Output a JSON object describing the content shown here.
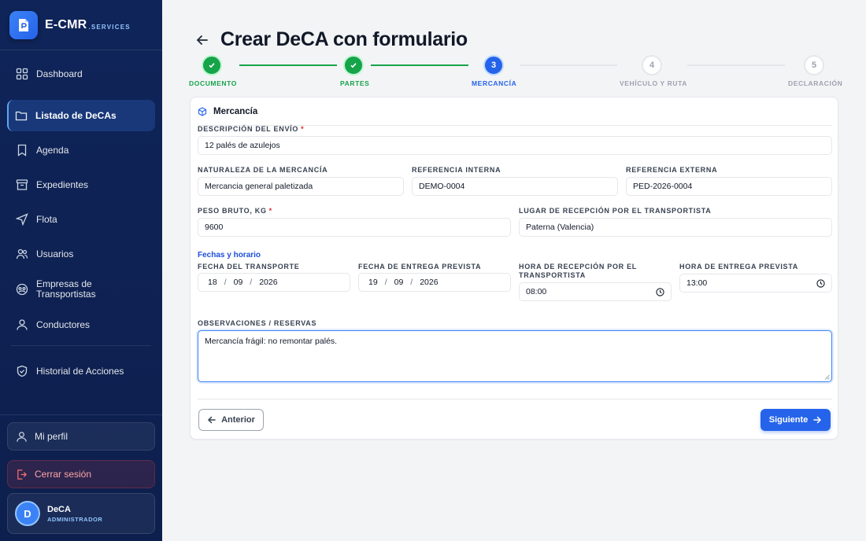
{
  "brand": {
    "name": "E-CMR",
    "sub": ".SERVICES"
  },
  "sidebar": {
    "items": [
      {
        "label": "Dashboard",
        "icon": "grid-icon"
      },
      {
        "label": "Listado de DeCAs",
        "icon": "folder-icon",
        "active": true
      },
      {
        "label": "Agenda",
        "icon": "bookmark-icon"
      },
      {
        "label": "Expedientes",
        "icon": "archive-icon"
      },
      {
        "label": "Flota",
        "icon": "navigation-icon"
      },
      {
        "label": "Usuarios",
        "icon": "users-icon"
      },
      {
        "label": "Empresas de Transportistas",
        "icon": "companies-icon"
      },
      {
        "label": "Conductores",
        "icon": "user-icon"
      },
      {
        "label": "Historial de Acciones",
        "icon": "shield-icon"
      }
    ],
    "profile_label": "Mi perfil",
    "logout_label": "Cerrar sesión",
    "user": {
      "initial": "D",
      "name": "DeCA",
      "role": "ADMINISTRADOR"
    }
  },
  "page": {
    "title": "Crear DeCA con formulario"
  },
  "stepper": {
    "steps": [
      {
        "number": "1",
        "label": "DOCUMENTO",
        "state": "done"
      },
      {
        "number": "2",
        "label": "PARTES",
        "state": "done"
      },
      {
        "number": "3",
        "label": "MERCANCÍA",
        "state": "current"
      },
      {
        "number": "4",
        "label": "VEHÍCULO Y RUTA",
        "state": "todo"
      },
      {
        "number": "5",
        "label": "DECLARACIÓN",
        "state": "todo"
      }
    ]
  },
  "form": {
    "section_title": "Mercancía",
    "descripcion": {
      "label": "DESCRIPCIÓN DEL ENVÍO",
      "required_mark": "*",
      "value": "12 palés de azulejos"
    },
    "naturaleza": {
      "label": "NATURALEZA DE LA MERCANCÍA",
      "value": "Mercancia general paletizada"
    },
    "ref_interna": {
      "label": "REFERENCIA INTERNA",
      "value": "DEMO-0004"
    },
    "ref_externa": {
      "label": "REFERENCIA EXTERNA",
      "value": "PED-2026-0004"
    },
    "peso": {
      "label": "PESO BRUTO, KG",
      "required_mark": "*",
      "value": "9600"
    },
    "lugar": {
      "label": "LUGAR DE RECEPCIÓN POR EL TRANSPORTISTA",
      "value": "Paterna (Valencia)"
    },
    "fechas_title": "Fechas y horario",
    "fecha_transporte": {
      "label": "FECHA DEL TRANSPORTE",
      "day": "18",
      "month": "09",
      "year": "2026"
    },
    "fecha_entrega": {
      "label": "FECHA DE ENTREGA PREVISTA",
      "day": "19",
      "month": "09",
      "year": "2026"
    },
    "hora_recepcion": {
      "label": "HORA DE RECEPCIÓN POR EL TRANSPORTISTA",
      "value": "08:00"
    },
    "hora_entrega": {
      "label": "HORA DE ENTREGA PREVISTA",
      "value": "13:00"
    },
    "observaciones": {
      "label": "OBSERVACIONES / RESERVAS",
      "value": "Mercancía frágil: no remontar palés."
    }
  },
  "actions": {
    "prev_label": "Anterior",
    "next_label": "Siguiente"
  },
  "colors": {
    "accent": "#2563eb",
    "success": "#16a34a",
    "sidebar": "#0f2459",
    "danger": "#ef4444"
  }
}
